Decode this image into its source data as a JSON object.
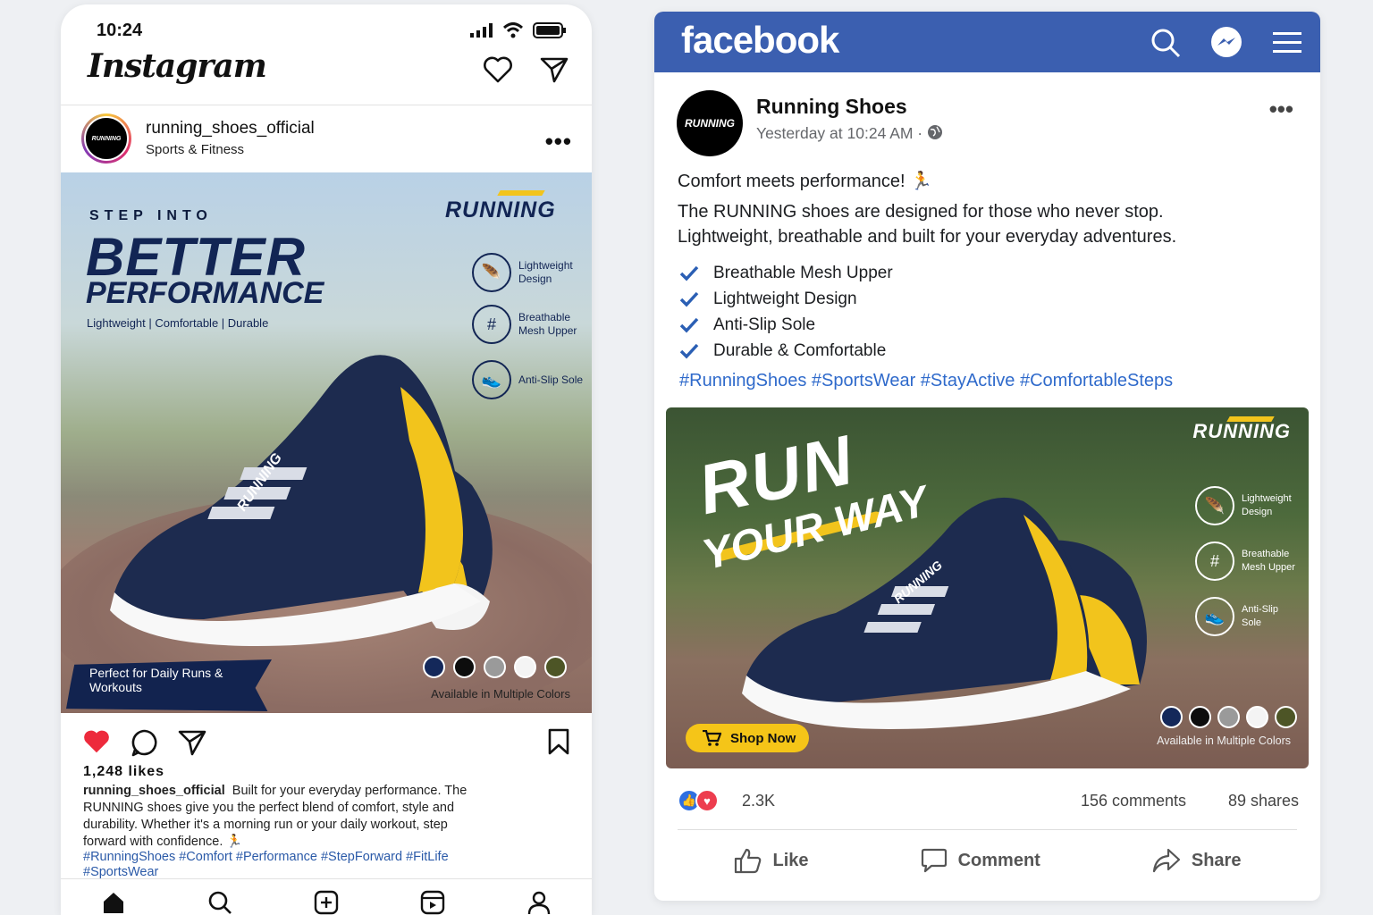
{
  "instagram": {
    "status_time": "10:24",
    "logo": "Instagram",
    "account": {
      "username": "running_shoes_official",
      "category": "Sports & Fitness",
      "avatar_text": "RUNNING"
    },
    "ad": {
      "headline_small": "STEP INTO",
      "headline_big": "BETTER",
      "headline_sub": "PERFORMANCE",
      "taglines": "Lightweight  |  Comfortable  |  Durable",
      "brand": "RUNNING",
      "shoe_brand": "RUNNING",
      "features": [
        {
          "icon": "feather-icon",
          "label": "Lightweight Design"
        },
        {
          "icon": "mesh-icon",
          "label": "Breathable Mesh Upper"
        },
        {
          "icon": "sole-icon",
          "label": "Anti-Slip Sole"
        }
      ],
      "badge": "Perfect for Daily Runs & Workouts",
      "colors_label": "Available in Multiple Colors",
      "swatches": [
        "#14285a",
        "#0d0d0d",
        "#9a9a9a",
        "#f4f4f4",
        "#4d5526"
      ]
    },
    "likes": "1,248 likes",
    "caption_user": "running_shoes_official",
    "caption": "Built for your everyday performance. The RUNNING shoes give you the perfect blend of comfort, style and durability. Whether it's a morning run or your daily workout, step forward with confidence. 🏃",
    "hashtags": "#RunningShoes #Comfort #Performance #StepForward #FitLife #SportsWear"
  },
  "facebook": {
    "logo": "facebook",
    "page_name": "Running Shoes",
    "avatar_text": "RUNNING",
    "post_time": "Yesterday at 10:24 AM ·",
    "text_intro": "Comfort meets performance! 🏃",
    "text_body": "The RUNNING shoes are designed for those who never stop. Lightweight, breathable and built for your everyday adventures.",
    "checklist": [
      "Breathable Mesh Upper",
      "Lightweight Design",
      "Anti-Slip Sole",
      "Durable & Comfortable"
    ],
    "hashtags": "#RunningShoes #SportsWear #StayActive #ComfortableSteps",
    "ad": {
      "headline_1": "RUN",
      "headline_2": "YOUR WAY",
      "brand": "RUNNING",
      "shoe_brand": "RUNNING",
      "features": [
        {
          "icon": "feather-icon",
          "label": "Lightweight Design"
        },
        {
          "icon": "mesh-icon",
          "label": "Breathable Mesh Upper"
        },
        {
          "icon": "sole-icon",
          "label": "Anti-Slip Sole"
        }
      ],
      "cta": "Shop Now",
      "colors_label": "Available in Multiple Colors",
      "swatches": [
        "#14285a",
        "#0d0d0d",
        "#9a9a9a",
        "#f4f4f4",
        "#4d5526"
      ]
    },
    "reactions_count": "2.3K",
    "comments": "156 comments",
    "shares": "89 shares",
    "buttons": {
      "like": "Like",
      "comment": "Comment",
      "share": "Share"
    }
  }
}
